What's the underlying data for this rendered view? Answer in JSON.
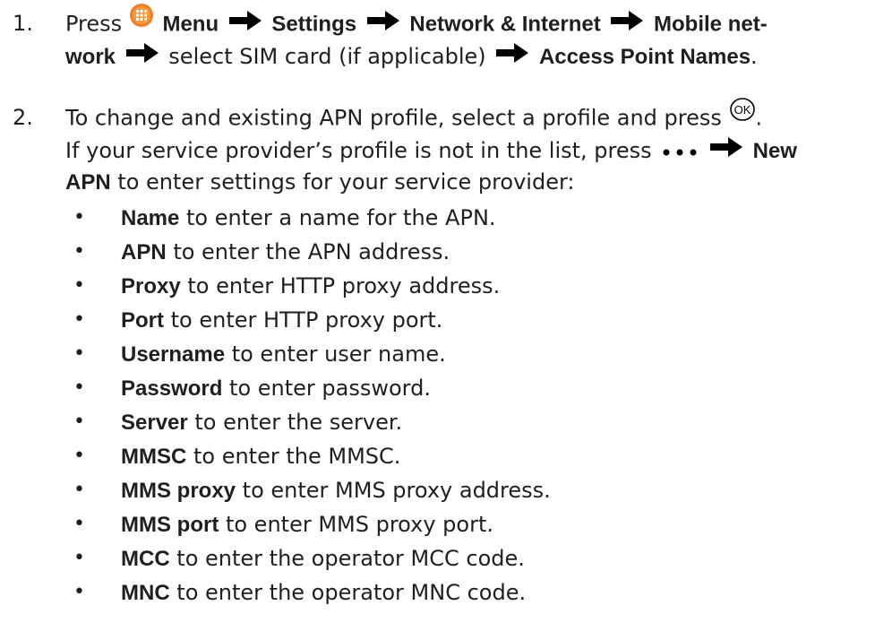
{
  "steps": [
    {
      "number": "1.",
      "text_press": "Press",
      "menu": "Menu",
      "settings": "Settings",
      "network": "Network & Internet",
      "mobile_a": "Mobile net-",
      "mobile_b": "work",
      "select_sim": "select SIM card (if applicable)",
      "apn_names": "Access Point Names",
      "period": "."
    },
    {
      "number": "2.",
      "line1": "To change and existing APN profile, select a profile and press",
      "period": ".",
      "line2": "If your service provider’s profile is not in the list, press",
      "new": "New",
      "apn": "APN",
      "line3_rest": "to enter settings for your service provider:"
    }
  ],
  "bullets": [
    {
      "term": "Name",
      "desc": "to enter a name for the APN."
    },
    {
      "term": "APN",
      "desc": "to enter the APN address."
    },
    {
      "term": "Proxy",
      "desc": "to enter HTTP proxy address."
    },
    {
      "term": "Port",
      "desc": "to enter HTTP proxy port."
    },
    {
      "term": "Username",
      "desc": "to enter user name."
    },
    {
      "term": "Password",
      "desc": "to enter password."
    },
    {
      "term": "Server",
      "desc": "to enter the server."
    },
    {
      "term": "MMSC",
      "desc": "to enter the MMSC."
    },
    {
      "term": "MMS proxy",
      "desc": "to enter MMS proxy address."
    },
    {
      "term": "MMS port",
      "desc": "to enter MMS proxy port."
    },
    {
      "term": "MCC",
      "desc": "to enter the operator MCC code."
    },
    {
      "term": "MNC",
      "desc": "to enter the operator MNC code."
    }
  ],
  "bullet_char": "•",
  "icons": {
    "menu": "menu-grid-icon",
    "arrow": "right-arrow-icon",
    "ok": "ok-button-icon",
    "more": "more-dots-icon"
  },
  "colors": {
    "text": "#1f1f1f",
    "menu_icon": "#f07d2a"
  }
}
